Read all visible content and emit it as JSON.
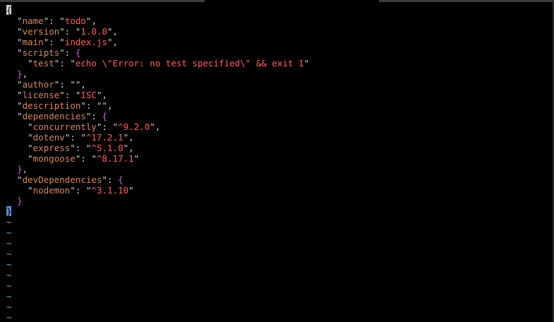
{
  "editor": {
    "open_brace": "{",
    "close_brace": "}",
    "lines": [
      {
        "indent": "  ",
        "key": "name",
        "value": "todo",
        "suffix": ","
      },
      {
        "indent": "  ",
        "key": "version",
        "value": "1.0.0",
        "suffix": ","
      },
      {
        "indent": "  ",
        "key": "main",
        "value": "index.js",
        "suffix": ","
      },
      {
        "indent": "  ",
        "key": "scripts",
        "open": "{"
      },
      {
        "indent": "    ",
        "key": "test",
        "value": "echo \\\"Error: no test specified\\\" && exit 1",
        "suffix": ""
      },
      {
        "indent": "  ",
        "close": "}",
        "suffix": ","
      },
      {
        "indent": "  ",
        "key": "author",
        "value": "",
        "suffix": ","
      },
      {
        "indent": "  ",
        "key": "license",
        "value": "ISC",
        "suffix": ","
      },
      {
        "indent": "  ",
        "key": "description",
        "value": "",
        "suffix": ","
      },
      {
        "indent": "  ",
        "key": "dependencies",
        "open": "{"
      },
      {
        "indent": "    ",
        "key": "concurrently",
        "value": "^9.2.0",
        "suffix": ","
      },
      {
        "indent": "    ",
        "key": "dotenv",
        "value": "^17.2.1",
        "suffix": ","
      },
      {
        "indent": "    ",
        "key": "express",
        "value": "^5.1.0",
        "suffix": ","
      },
      {
        "indent": "    ",
        "key": "mongoose",
        "value": "^8.17.1",
        "suffix": ""
      },
      {
        "indent": "  ",
        "close": "}",
        "suffix": ","
      },
      {
        "indent": "  ",
        "key": "devDependencies",
        "open": "{"
      },
      {
        "indent": "    ",
        "key": "nodemon",
        "value": "^3.1.10",
        "suffix": ""
      },
      {
        "indent": "  ",
        "close": "}",
        "suffix": ""
      }
    ],
    "tilde": "~",
    "tilde_count": 10
  },
  "colors": {
    "background": "#000000",
    "key": "#d7875f",
    "string": "#ff5f5f",
    "brace": "#d75fd7",
    "tilde": "#5fafd7",
    "punctuation": "#d0d0d0"
  }
}
